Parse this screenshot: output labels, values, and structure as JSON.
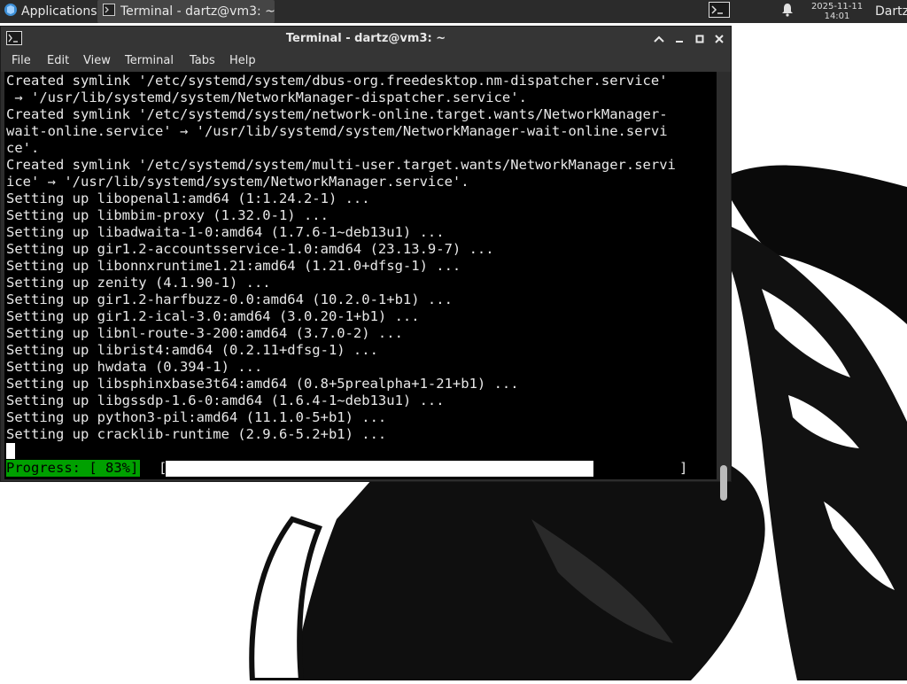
{
  "panel": {
    "applications_label": "Applications",
    "task_label": "Terminal - dartz@vm3: ~",
    "clock_date": "2025-11-11",
    "clock_time": "14:01",
    "user_label": "Dartz"
  },
  "window": {
    "title": "Terminal - dartz@vm3: ~",
    "menu": [
      "File",
      "Edit",
      "View",
      "Terminal",
      "Tabs",
      "Help"
    ]
  },
  "terminal": {
    "lines": [
      "Created symlink '/etc/systemd/system/dbus-org.freedesktop.nm-dispatcher.service'",
      " → '/usr/lib/systemd/system/NetworkManager-dispatcher.service'.",
      "Created symlink '/etc/systemd/system/network-online.target.wants/NetworkManager-",
      "wait-online.service' → '/usr/lib/systemd/system/NetworkManager-wait-online.servi",
      "ce'.",
      "Created symlink '/etc/systemd/system/multi-user.target.wants/NetworkManager.servi",
      "ice' → '/usr/lib/systemd/system/NetworkManager.service'.",
      "Setting up libopenal1:amd64 (1:1.24.2-1) ...",
      "Setting up libmbim-proxy (1.32.0-1) ...",
      "Setting up libadwaita-1-0:amd64 (1.7.6-1~deb13u1) ...",
      "Setting up gir1.2-accountsservice-1.0:amd64 (23.13.9-7) ...",
      "Setting up libonnxruntime1.21:amd64 (1.21.0+dfsg-1) ...",
      "Setting up zenity (4.1.90-1) ...",
      "Setting up gir1.2-harfbuzz-0.0:amd64 (10.2.0-1+b1) ...",
      "Setting up gir1.2-ical-3.0:amd64 (3.0.20-1+b1) ...",
      "Setting up libnl-route-3-200:amd64 (3.7.0-2) ...",
      "Setting up librist4:amd64 (0.2.11+dfsg-1) ...",
      "Setting up hwdata (0.394-1) ...",
      "Setting up libsphinxbase3t64:amd64 (0.8+5prealpha+1-21+b1) ...",
      "Setting up libgssdp-1.6-0:amd64 (1.6.4-1~deb13u1) ...",
      "Setting up python3-pil:amd64 (11.1.0-5+b1) ...",
      "Setting up cracklib-runtime (2.9.6-5.2+b1) ..."
    ],
    "progress_label": "Progress: [ 83%]",
    "progress_open": "[",
    "progress_close": "]",
    "progress_fraction": 0.83
  },
  "colors": {
    "progress_label_bg": "#00a000",
    "terminal_bg": "#000000",
    "panel_bg": "#2b2b2b"
  }
}
